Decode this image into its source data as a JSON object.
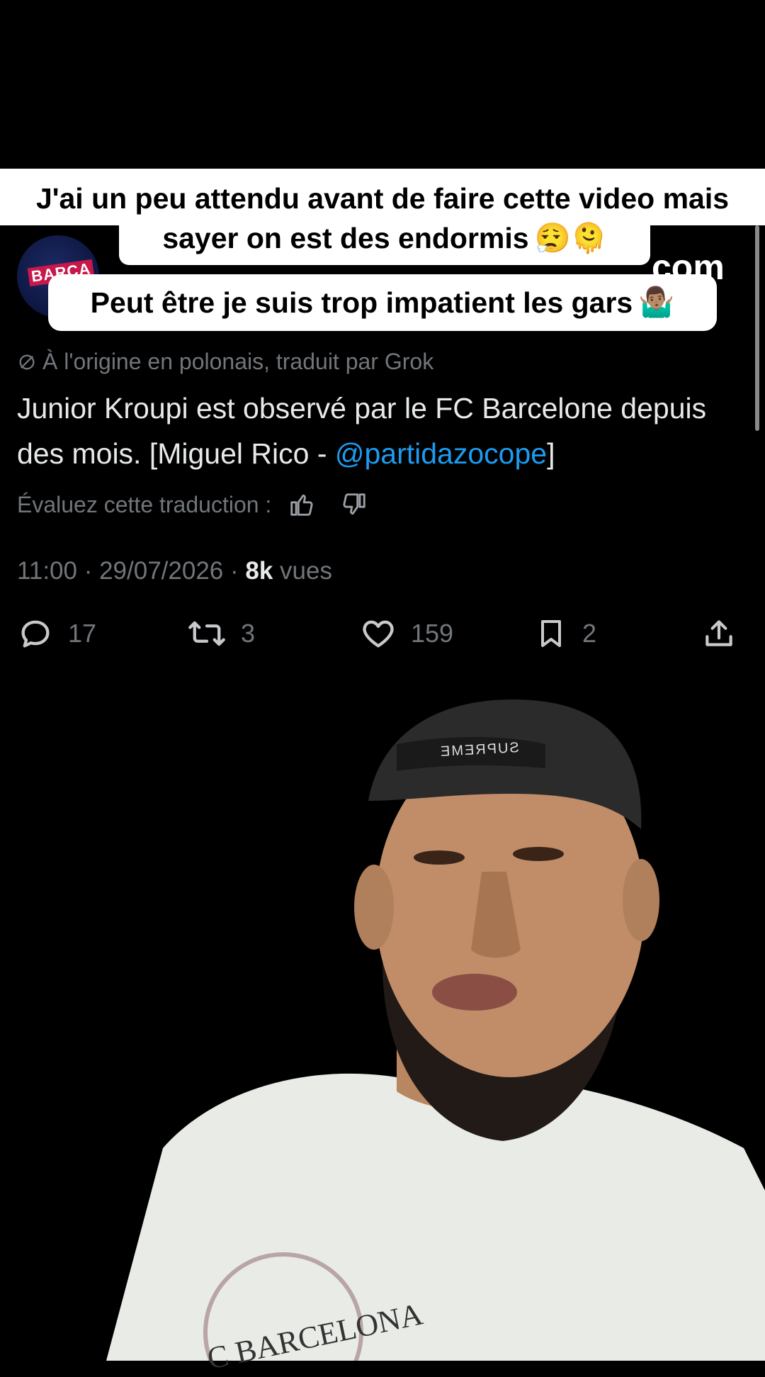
{
  "captions": {
    "line1": "J'ai un peu attendu avant de faire cette video mais",
    "line2": "sayer on est des endormis",
    "line2_emojis": "😮‍💨🫠",
    "line3": "Peut être je suis trop impatient les gars",
    "line3_emoji": "🤷🏽‍♂️"
  },
  "tweet": {
    "avatar_badge": "BARCA",
    "handle_tail": "com",
    "translated_note": "À l'origine en polonais, traduit par Grok",
    "text_main": "Junior Kroupi est observé par le FC Barcelone depuis des mois. [Miguel Rico - ",
    "mention": "@partidazocope",
    "text_end": "]",
    "rate_label": "Évaluez cette traduction :",
    "timestamp": "11:00 · 29/07/2026 · ",
    "views_count": "8k",
    "views_label": " vues",
    "actions": {
      "replies": "17",
      "reposts": "3",
      "likes": "159",
      "bookmarks": "2"
    }
  },
  "video": {
    "cap_logo_text": "SUPREME",
    "shirt_text": "C BARCELONA"
  },
  "colors": {
    "background": "#000000",
    "caption_bg": "#ffffff",
    "tweet_text": "#e7e9ea",
    "muted": "#71767b",
    "link": "#1d9bf0"
  }
}
